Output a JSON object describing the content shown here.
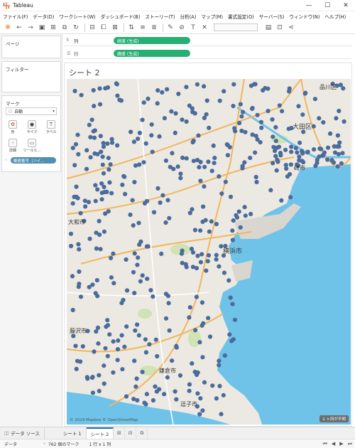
{
  "window": {
    "title": "Tableau",
    "controls": {
      "minimize": "—",
      "maximize": "☐",
      "close": "✕"
    }
  },
  "menu": [
    "ファイル(F)",
    "データ(D)",
    "ワークシート(W)",
    "ダッシュボード(B)",
    "ストーリー(T)",
    "分析(A)",
    "マップ(M)",
    "書式設定(O)",
    "サーバー(S)",
    "ウィンドウ(N)",
    "ヘルプ(H)"
  ],
  "left_panel": {
    "pages_title": "ページ",
    "filters_title": "フィルター",
    "marks_title": "マーク",
    "mark_type": "自動",
    "buttons": {
      "color": "色",
      "size": "サイズ",
      "label": "ラベル",
      "detail": "詳細",
      "tooltip": "ツールヒ..."
    },
    "field_pill": "郵便番号（ハイ..."
  },
  "shelves": {
    "columns_label": "列",
    "columns_pill": "経度 (生成)",
    "rows_label": "行",
    "rows_pill": "緯度 (生成)"
  },
  "sheet": {
    "title": "シート 2",
    "map_labels": {
      "shinagawa": "品川区",
      "ota": "大田区",
      "kawasaki": "崎市",
      "yamato": "大和市",
      "yokohama": "横浜市",
      "fujisawa": "藤沢市",
      "kamakura": "鎌倉市",
      "zushi": "逗子市"
    },
    "attribution": "© 2019 Mapbox © OpenStreetMap",
    "unknown_badge": "1 ヶ所が不明",
    "marker_color": "#4a6b9b"
  },
  "tabs": {
    "datasource": "データ ソース",
    "sheet1": "シート 1",
    "sheet2": "シート 2"
  },
  "status": {
    "data": "データ",
    "marks": "762 個のマーク",
    "rowscols": "1 行 x 1 列"
  }
}
